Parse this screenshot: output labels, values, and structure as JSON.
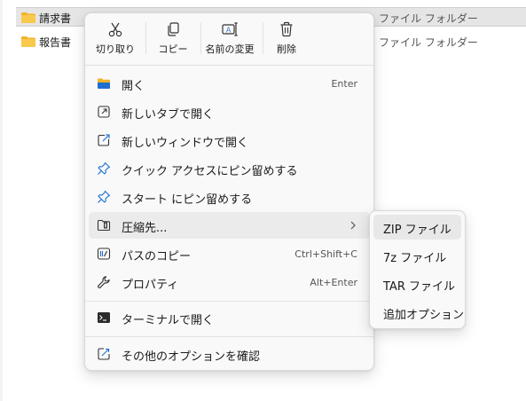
{
  "files": [
    {
      "name": "請求書",
      "type": "ファイル フォルダー",
      "selected": true
    },
    {
      "name": "報告書",
      "type": "ファイル フォルダー",
      "selected": false
    }
  ],
  "context_menu": {
    "quick_actions": [
      {
        "label": "切り取り",
        "icon": "cut-icon"
      },
      {
        "label": "コピー",
        "icon": "copy-icon"
      },
      {
        "label": "名前の変更",
        "icon": "rename-icon"
      },
      {
        "label": "削除",
        "icon": "delete-icon"
      }
    ],
    "items": [
      {
        "label": "開く",
        "shortcut": "Enter",
        "icon": "folder-open-icon"
      },
      {
        "label": "新しいタブで開く",
        "shortcut": "",
        "icon": "new-tab-icon"
      },
      {
        "label": "新しいウィンドウで開く",
        "shortcut": "",
        "icon": "new-window-icon"
      },
      {
        "label": "クイック アクセスにピン留めする",
        "shortcut": "",
        "icon": "pin-icon"
      },
      {
        "label": "スタート にピン留めする",
        "shortcut": "",
        "icon": "pin-start-icon"
      },
      {
        "label": "圧縮先...",
        "shortcut": "",
        "icon": "zip-icon",
        "has_submenu": true
      },
      {
        "label": "パスのコピー",
        "shortcut": "Ctrl+Shift+C",
        "icon": "copy-path-icon"
      },
      {
        "label": "プロパティ",
        "shortcut": "Alt+Enter",
        "icon": "wrench-icon"
      },
      {
        "label": "ターミナルで開く",
        "shortcut": "",
        "icon": "terminal-icon"
      },
      {
        "label": "その他のオプションを確認",
        "shortcut": "",
        "icon": "more-options-icon"
      }
    ]
  },
  "submenu": {
    "items": [
      {
        "label": "ZIP ファイル"
      },
      {
        "label": "7z ファイル"
      },
      {
        "label": "TAR ファイル"
      },
      {
        "label": "追加オプション"
      }
    ]
  },
  "colors": {
    "folder": "#f0b429",
    "accent_blue": "#1f6fd1"
  }
}
